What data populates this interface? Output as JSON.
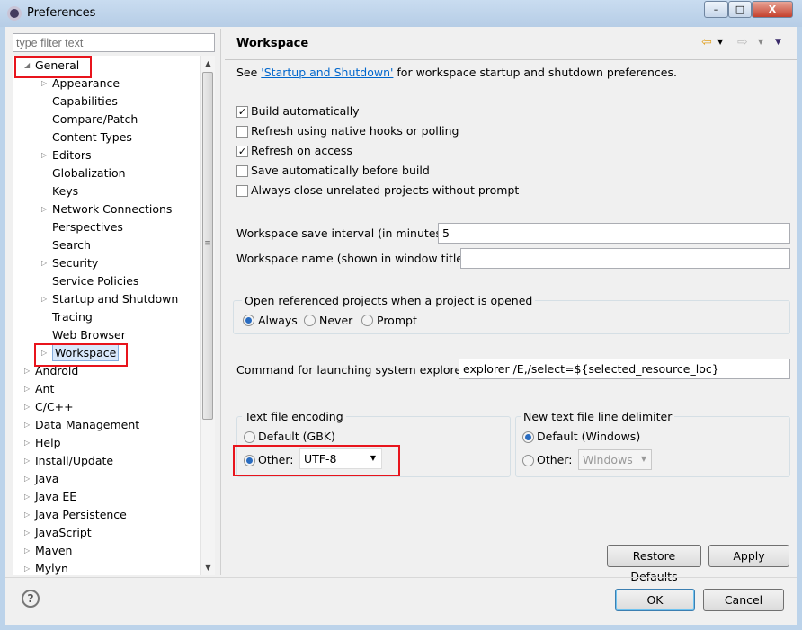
{
  "window": {
    "title": "Preferences",
    "minimize": "–",
    "maximize": "□",
    "close": "X"
  },
  "filter": {
    "placeholder": "type filter text"
  },
  "tree": [
    {
      "label": "General",
      "level": 0,
      "expanded": true
    },
    {
      "label": "Appearance",
      "level": 1,
      "children": true
    },
    {
      "label": "Capabilities",
      "level": 1
    },
    {
      "label": "Compare/Patch",
      "level": 1
    },
    {
      "label": "Content Types",
      "level": 1
    },
    {
      "label": "Editors",
      "level": 1,
      "children": true
    },
    {
      "label": "Globalization",
      "level": 1
    },
    {
      "label": "Keys",
      "level": 1
    },
    {
      "label": "Network Connections",
      "level": 1,
      "children": true
    },
    {
      "label": "Perspectives",
      "level": 1
    },
    {
      "label": "Search",
      "level": 1
    },
    {
      "label": "Security",
      "level": 1,
      "children": true
    },
    {
      "label": "Service Policies",
      "level": 1
    },
    {
      "label": "Startup and Shutdown",
      "level": 1,
      "children": true
    },
    {
      "label": "Tracing",
      "level": 1
    },
    {
      "label": "Web Browser",
      "level": 1
    },
    {
      "label": "Workspace",
      "level": 1,
      "children": true,
      "selected": true
    },
    {
      "label": "Android",
      "level": 0,
      "children": true
    },
    {
      "label": "Ant",
      "level": 0,
      "children": true
    },
    {
      "label": "C/C++",
      "level": 0,
      "children": true
    },
    {
      "label": "Data Management",
      "level": 0,
      "children": true
    },
    {
      "label": "Help",
      "level": 0,
      "children": true
    },
    {
      "label": "Install/Update",
      "level": 0,
      "children": true
    },
    {
      "label": "Java",
      "level": 0,
      "children": true
    },
    {
      "label": "Java EE",
      "level": 0,
      "children": true
    },
    {
      "label": "Java Persistence",
      "level": 0,
      "children": true
    },
    {
      "label": "JavaScript",
      "level": 0,
      "children": true
    },
    {
      "label": "Maven",
      "level": 0,
      "children": true
    },
    {
      "label": "Mylyn",
      "level": 0,
      "children": true
    }
  ],
  "page": {
    "title": "Workspace",
    "see_prefix": "See ",
    "see_link": "'Startup and Shutdown'",
    "see_suffix": " for workspace startup and shutdown preferences.",
    "checkboxes": [
      {
        "label": "Build automatically",
        "checked": true
      },
      {
        "label": "Refresh using native hooks or polling",
        "checked": false
      },
      {
        "label": "Refresh on access",
        "checked": true
      },
      {
        "label": "Save automatically before build",
        "checked": false
      },
      {
        "label": "Always close unrelated projects without prompt",
        "checked": false
      }
    ],
    "save_interval_label": "Workspace save interval (in minutes):",
    "save_interval_value": "5",
    "ws_name_label": "Workspace name (shown in window title):",
    "ws_name_value": "",
    "open_ref": {
      "title": "Open referenced projects when a project is opened",
      "options": [
        "Always",
        "Never",
        "Prompt"
      ],
      "selected": "Always"
    },
    "explorer_label": "Command for launching system explorer:",
    "explorer_value": "explorer /E,/select=${selected_resource_loc}",
    "encoding": {
      "title": "Text file encoding",
      "default_label": "Default (GBK)",
      "other_label": "Other:",
      "selected": "Other",
      "value": "UTF-8"
    },
    "delimiter": {
      "title": "New text file line delimiter",
      "default_label": "Default (Windows)",
      "other_label": "Other:",
      "selected": "Default",
      "value": "Windows"
    },
    "restore_defaults": "Restore Defaults",
    "apply": "Apply"
  },
  "footer": {
    "help": "?",
    "ok": "OK",
    "cancel": "Cancel"
  },
  "colors": {
    "highlight": "#e8141c",
    "link": "#0066cc"
  }
}
